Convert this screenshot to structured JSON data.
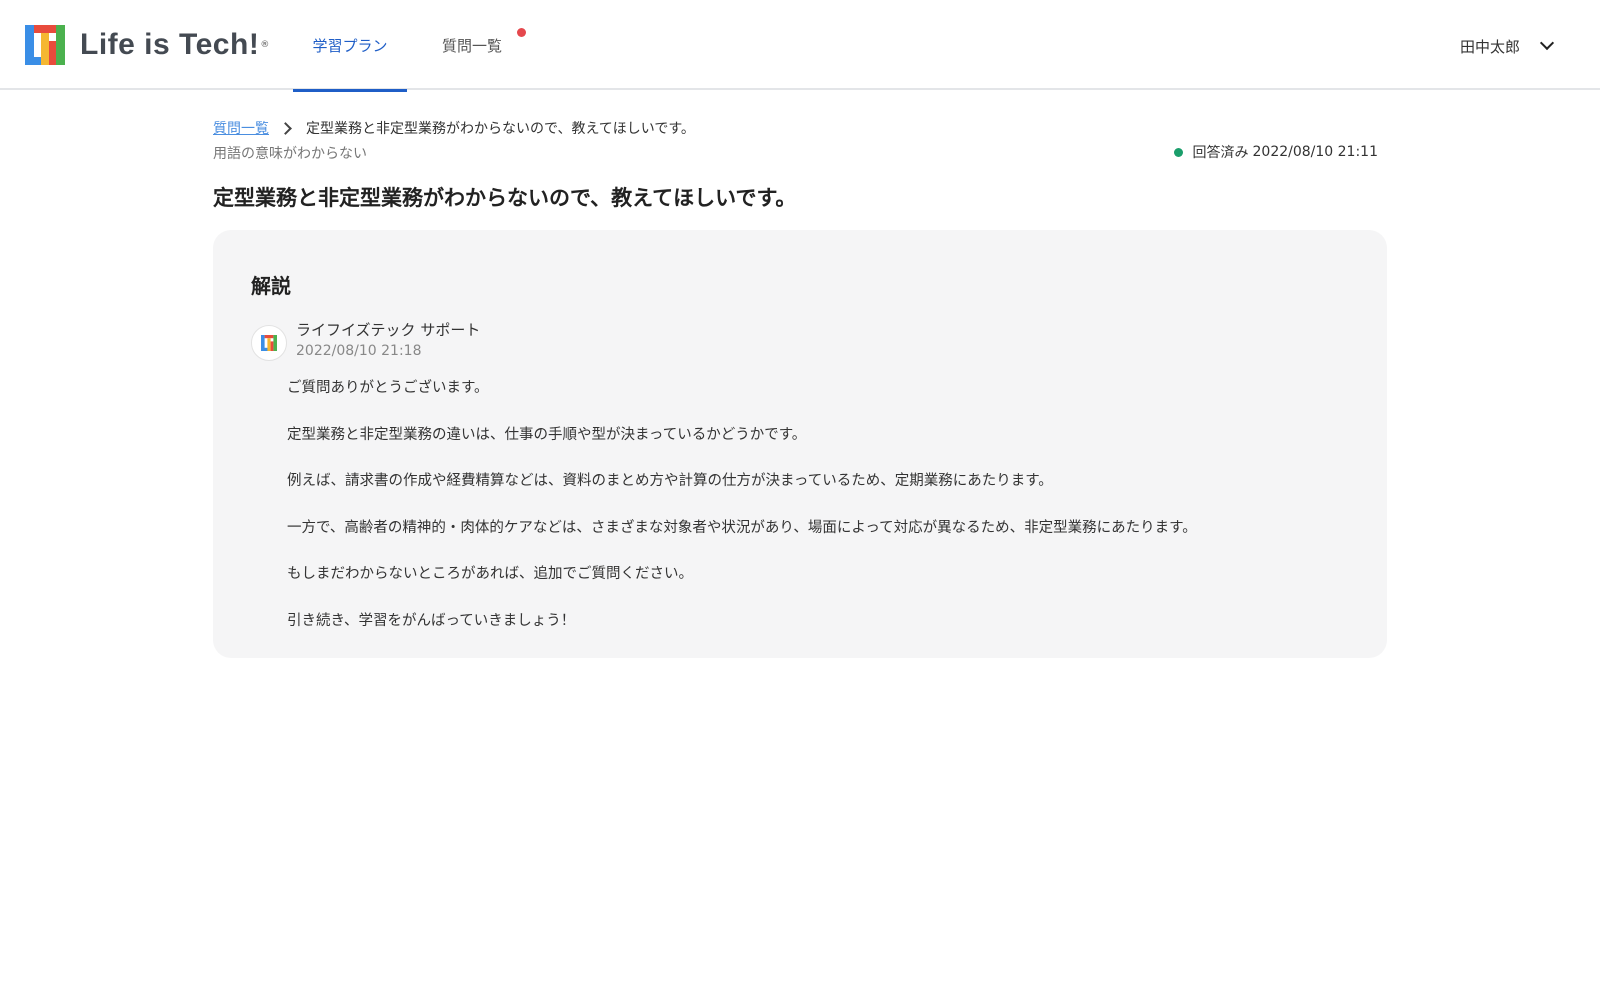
{
  "header": {
    "logo_text": "Life is Tech!",
    "logo_reg": "®",
    "tabs": [
      {
        "label": "学習プラン",
        "active": true
      },
      {
        "label": "質問一覧",
        "active": false,
        "has_notification": true
      }
    ],
    "user_name": "田中太郎"
  },
  "breadcrumb": {
    "parent": "質問一覧",
    "current": "定型業務と非定型業務がわからないので、教えてほしいです。"
  },
  "question": {
    "category": "用語の意味がわからない",
    "status_label": "回答済み",
    "status_date": "2022/08/10 21:11",
    "title": "定型業務と非定型業務がわからないので、教えてほしいです。"
  },
  "answer": {
    "heading": "解説",
    "author": "ライフイズテック サポート",
    "date": "2022/08/10 21:18",
    "paragraphs": [
      "ご質問ありがとうございます。",
      "定型業務と非定型業務の違いは、仕事の手順や型が決まっているかどうかです。",
      "例えば、請求書の作成や経費精算などは、資料のまとめ方や計算の仕方が決まっているため、定期業務にあたります。",
      "一方で、高齢者の精神的・肉体的ケアなどは、さまざまな対象者や状況があり、場面によって対応が異なるため、非定型業務にあたります。",
      "もしまだわからないところがあれば、追加でご質問ください。",
      "引き続き、学習をがんばっていきましょう！"
    ]
  },
  "colors": {
    "accent": "#1f5ec7",
    "link": "#4a8ee0",
    "status_answered": "#1a9e6b",
    "notification": "#e5484d",
    "card_bg": "#f5f5f6"
  },
  "icons": {
    "logo": "lifeistech-logo-mark",
    "chevron": "chevron-down-icon",
    "breadcrumb_separator": "chevron-right-icon",
    "status": "status-dot-icon",
    "avatar": "support-avatar-icon"
  }
}
